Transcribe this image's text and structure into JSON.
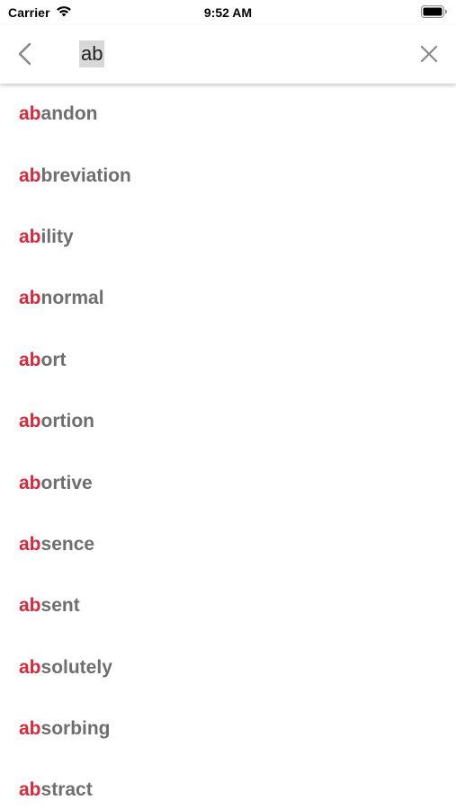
{
  "status_bar": {
    "carrier": "Carrier",
    "time": "9:52 AM"
  },
  "search": {
    "query": "ab",
    "back_icon": "chevron-left-icon",
    "clear_icon": "close-icon"
  },
  "colors": {
    "match": "#d8283c",
    "rest": "#6e6e6e"
  },
  "results": [
    {
      "match": "ab",
      "rest": "andon"
    },
    {
      "match": "ab",
      "rest": "breviation"
    },
    {
      "match": "ab",
      "rest": "ility"
    },
    {
      "match": "ab",
      "rest": "normal"
    },
    {
      "match": "ab",
      "rest": "ort"
    },
    {
      "match": "ab",
      "rest": "ortion"
    },
    {
      "match": "ab",
      "rest": "ortive"
    },
    {
      "match": "ab",
      "rest": "sence"
    },
    {
      "match": "ab",
      "rest": "sent"
    },
    {
      "match": "ab",
      "rest": "solutely"
    },
    {
      "match": "ab",
      "rest": "sorbing"
    },
    {
      "match": "ab",
      "rest": "stract"
    }
  ]
}
